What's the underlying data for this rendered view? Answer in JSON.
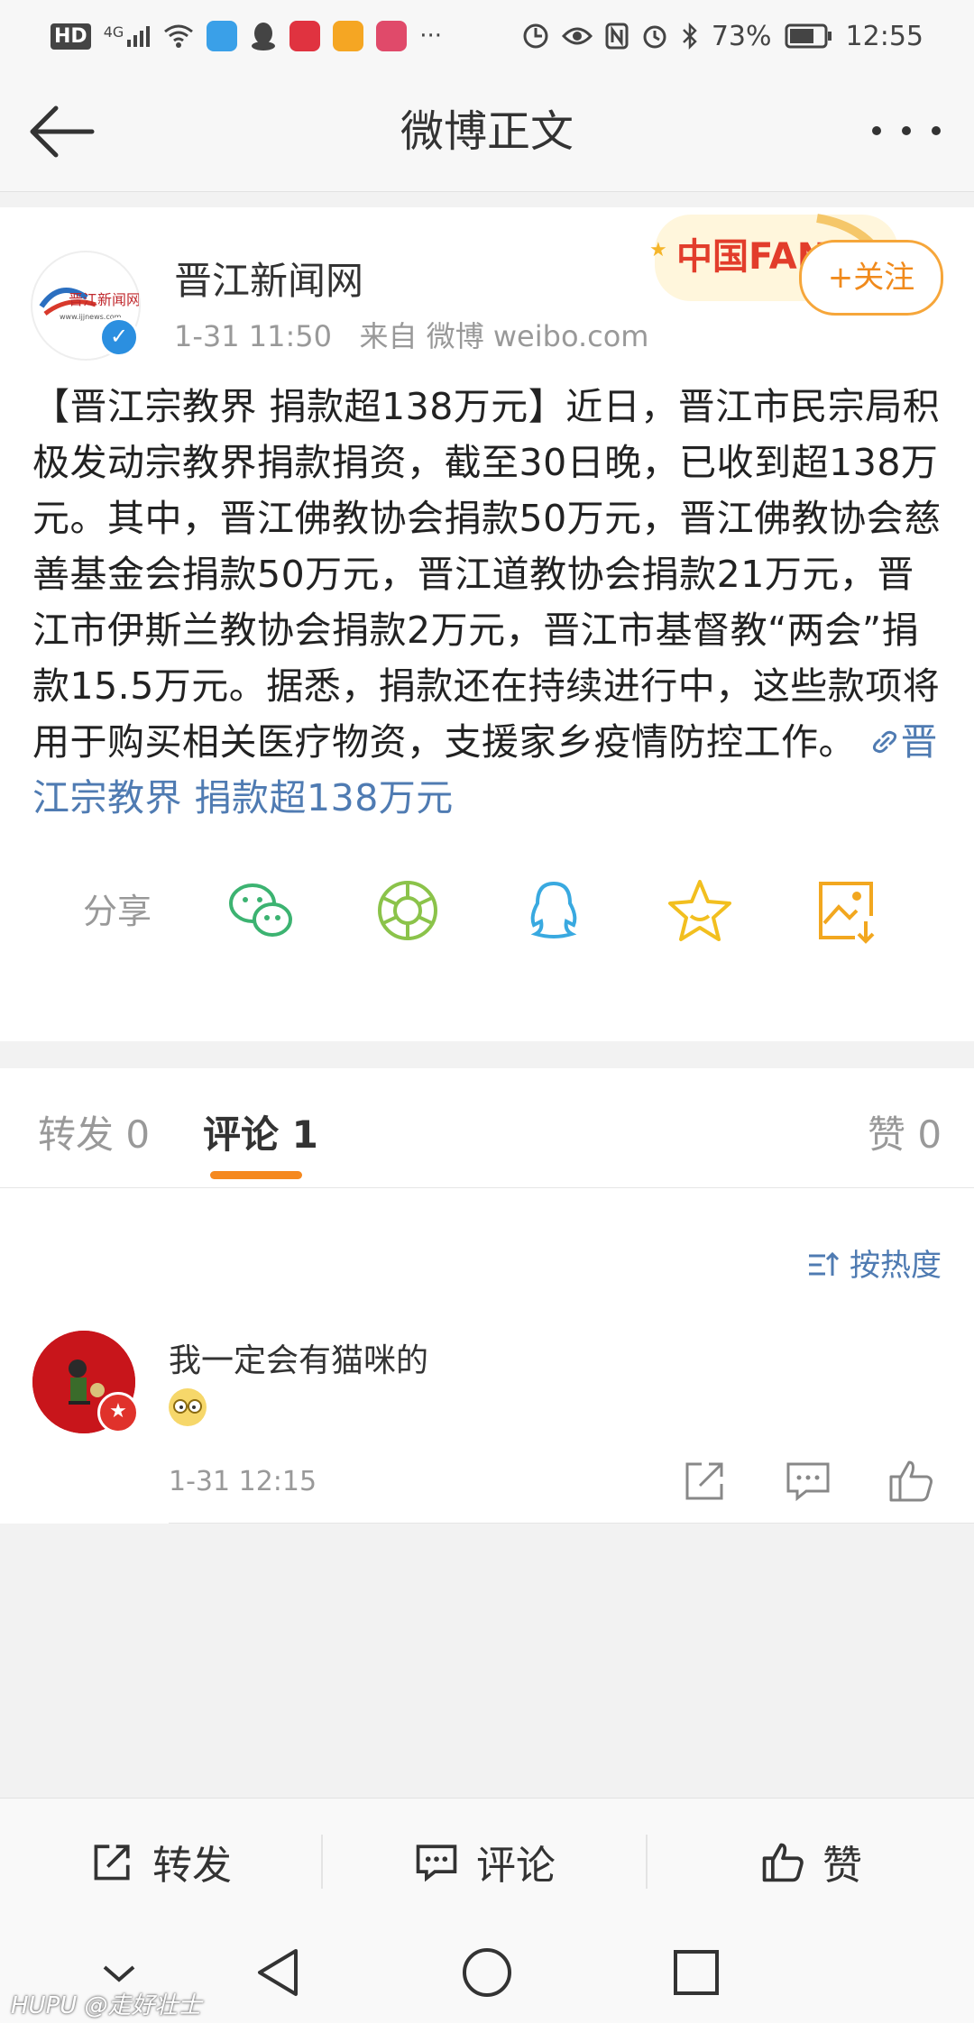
{
  "status_bar": {
    "left_text": "HD",
    "signal_label": "4G",
    "battery": "73%",
    "time": "12:55"
  },
  "nav": {
    "title": "微博正文"
  },
  "post": {
    "author": "晋江新闻网",
    "time": "1-31 11:50",
    "source": "来自 微博 weibo.com",
    "follow_label": "+关注",
    "fans_badge": "中国FANS",
    "text": "【晋江宗教界 捐款超138万元】近日，晋江市民宗局积极发动宗教界捐款捐资，截至30日晚，已收到超138万元。其中，晋江佛教协会捐款50万元，晋江佛教协会慈善基金会捐款50万元，晋江道教协会捐款21万元，晋江市伊斯兰教协会捐款2万元，晋江市基督教“两会”捐款15.5万元。据悉，捐款还在持续进行中，这些款项将用于购买相关医疗物资，支援家乡疫情防控工作。",
    "link_text": "晋江宗教界 捐款超138万元",
    "share_label": "分享"
  },
  "tabs": {
    "repost": "转发 0",
    "comment": "评论 1",
    "like": "赞 0"
  },
  "comments": {
    "sort_label": "按热度",
    "items": [
      {
        "text": "我一定会有猫咪的",
        "time": "1-31 12:15"
      }
    ]
  },
  "action_bar": {
    "repost": "转发",
    "comment": "评论",
    "like": "赞"
  },
  "watermark": "HUPU @走好壮士",
  "colors": {
    "accent_orange": "#f5891f",
    "link_blue": "#4f7bb2",
    "verified_blue": "#2b8fe0"
  }
}
